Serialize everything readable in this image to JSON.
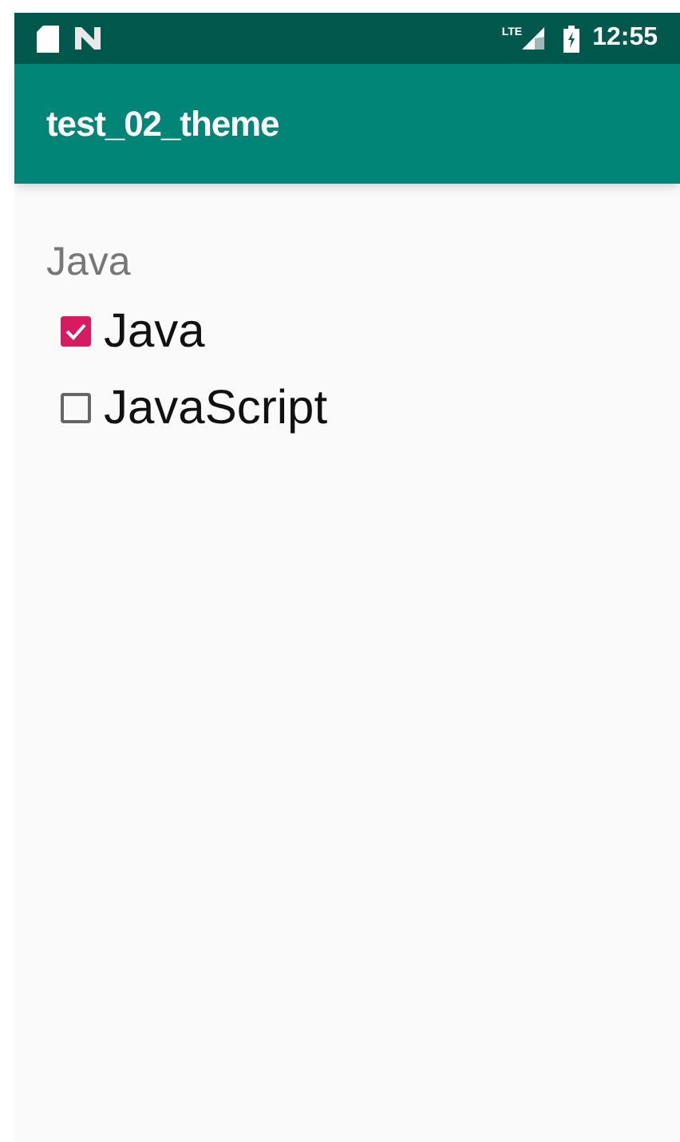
{
  "status_bar": {
    "time": "12:55",
    "network": "LTE"
  },
  "app_bar": {
    "title": "test_02_theme"
  },
  "group_label": "Java",
  "options": [
    {
      "label": "Java",
      "checked": true
    },
    {
      "label": "JavaScript",
      "checked": false
    }
  ]
}
